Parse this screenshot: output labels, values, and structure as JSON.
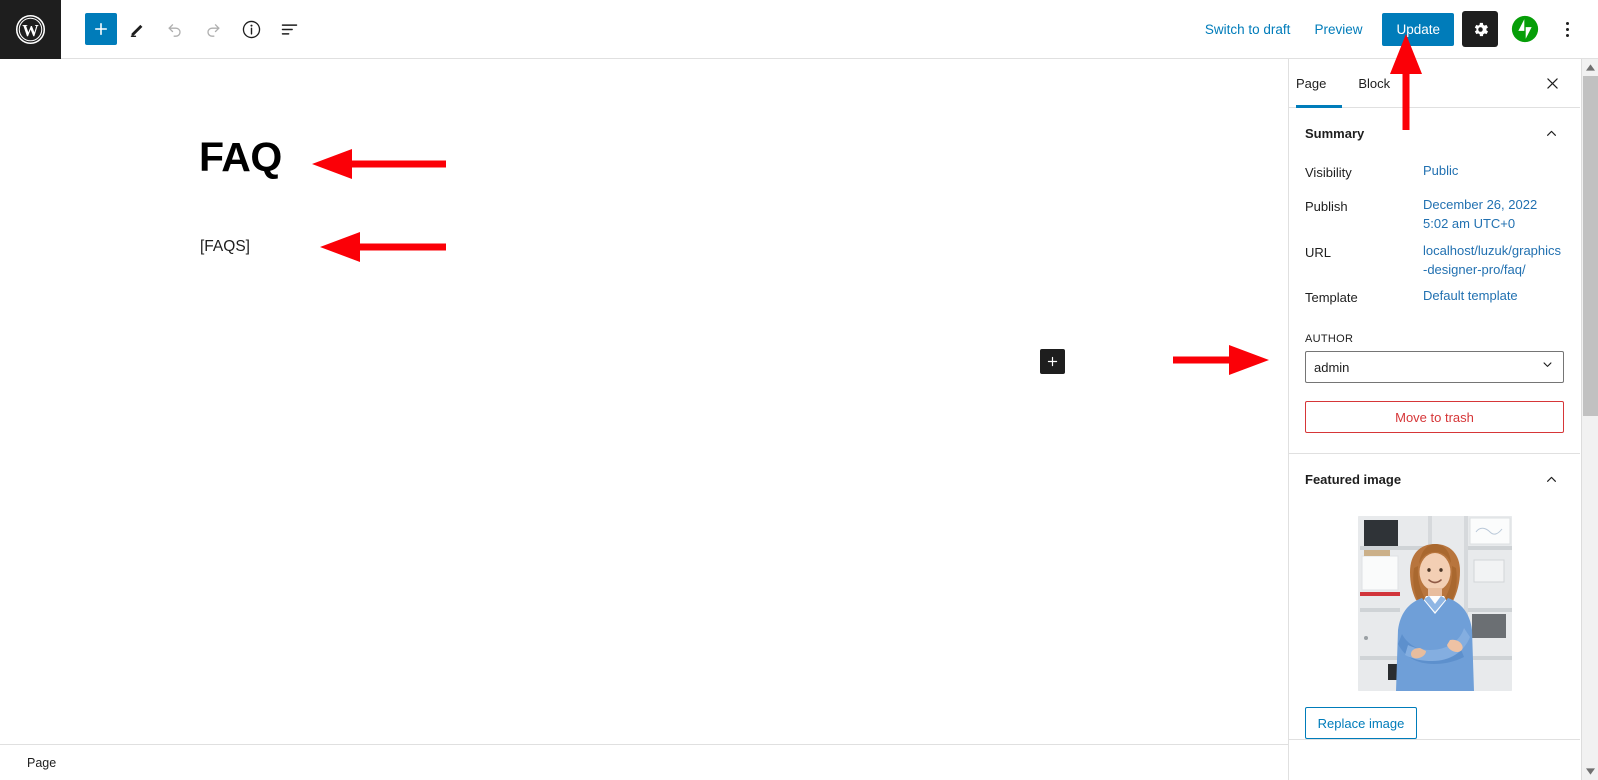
{
  "toolbar": {
    "logo_icon": "wordpress-logo-icon",
    "add_block_label": "+",
    "add_block_icon": "plus-icon",
    "edit_icon": "pencil-icon",
    "undo_icon": "undo-icon",
    "redo_icon": "redo-icon",
    "info_icon": "info-icon",
    "list_view_icon": "list-view-icon",
    "switch_to_draft_label": "Switch to draft",
    "preview_label": "Preview",
    "update_label": "Update",
    "settings_icon": "gear-icon",
    "jetpack_icon": "jetpack-icon",
    "more_icon": "kebab-menu-icon"
  },
  "editor": {
    "title": "FAQ",
    "body_text": "[FAQS]",
    "inserter_icon": "plus-icon",
    "breadcrumb": "Page"
  },
  "sidebar": {
    "tabs": [
      {
        "label": "Page",
        "active": true
      },
      {
        "label": "Block",
        "active": false
      }
    ],
    "close_icon": "close-icon",
    "summary": {
      "title": "Summary",
      "collapse_icon": "chevron-up-icon",
      "rows": [
        {
          "label": "Visibility",
          "value": "Public"
        },
        {
          "label": "Publish",
          "value": "December 26, 2022 5:02 am UTC+0"
        },
        {
          "label": "URL",
          "value": "localhost/luzuk/graphics-designer-pro/faq/"
        },
        {
          "label": "Template",
          "value": "Default template"
        }
      ],
      "author_label": "AUTHOR",
      "author_value": "admin",
      "author_chevron_icon": "chevron-down-icon",
      "trash_label": "Move to trash"
    },
    "featured_image": {
      "title": "Featured image",
      "collapse_icon": "chevron-up-icon",
      "image_alt": "Smiling woman in blue blazer standing in an office with white shelving",
      "replace_label": "Replace image"
    }
  },
  "scrollbar": {
    "up_icon": "scroll-up-arrow-icon",
    "down_icon": "scroll-down-arrow-icon",
    "thumb": "scrollbar-thumb"
  },
  "annotations": {
    "color": "#fb0007",
    "arrow_title": "arrow pointing to page title",
    "arrow_body": "arrow pointing to shortcode body text",
    "arrow_template": "arrow pointing to template row",
    "arrow_update": "arrow pointing to update button"
  },
  "colors": {
    "accent": "#007cba",
    "link": "#2271b1",
    "dark": "#1e1e1e",
    "danger": "#d63638",
    "jetpack_green": "#069e08",
    "annotation_red": "#fb0007"
  }
}
